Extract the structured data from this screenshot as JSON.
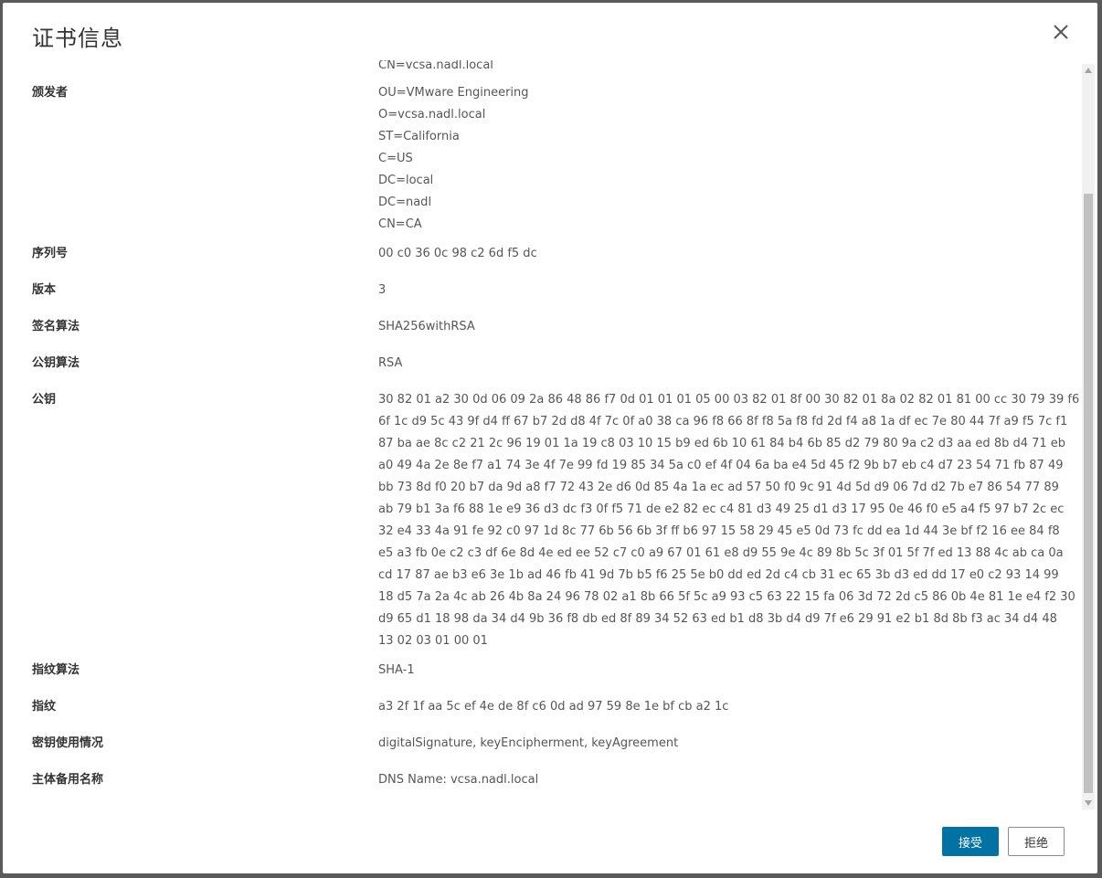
{
  "dialog": {
    "title": "证书信息",
    "close_icon": "close-icon"
  },
  "fields": {
    "subject_cn_partial": "CN=vcsa.nadl.local",
    "issuer": {
      "label": "颁发者",
      "lines": [
        "OU=VMware Engineering",
        "O=vcsa.nadl.local",
        "ST=California",
        "C=US",
        "DC=local",
        "DC=nadl",
        "CN=CA"
      ]
    },
    "serial": {
      "label": "序列号",
      "value": "00 c0 36 0c 98 c2 6d f5 dc"
    },
    "version": {
      "label": "版本",
      "value": "3"
    },
    "signature_algorithm": {
      "label": "签名算法",
      "value": "SHA256withRSA"
    },
    "public_key_algorithm": {
      "label": "公钥算法",
      "value": "RSA"
    },
    "public_key": {
      "label": "公钥",
      "lines": [
        "30 82 01 a2 30 0d 06 09 2a 86 48 86 f7 0d 01 01 01 05 00 03 82 01 8f 00 30 82 01 8a 02 82 01 81 00 cc 30 79 39 f6",
        "6f 1c d9 5c 43 9f d4 ff 67 b7 2d d8 4f 7c 0f a0 38 ca 96 f8 66 8f f8 5a f8 fd 2d f4 a8 1a df ec 7e 80 44 7f a9 f5 7c f1",
        "87 ba ae 8c c2 21 2c 96 19 01 1a 19 c8 03 10 15 b9 ed 6b 10 61 84 b4 6b 85 d2 79 80 9a c2 d3 aa ed 8b d4 71 eb",
        "a0 49 4a 2e 8e f7 a1 74 3e 4f 7e 99 fd 19 85 34 5a c0 ef 4f 04 6a ba e4 5d 45 f2 9b b7 eb c4 d7 23 54 71 fb 87 49",
        "bb 73 8d f0 20 b7 da 9d a8 f7 72 43 2e d6 0d 85 4a 1a ec ad 57 50 f0 9c 91 4d 5d d9 06 7d d2 7b e7 86 54 77 89",
        "ab 79 b1 3a f6 88 1e e9 36 d3 dc f3 0f f5 71 de e2 82 ec c4 81 d3 49 25 d1 d3 17 95 0e 46 f0 e5 a4 f5 97 b7 2c ec",
        "32 e4 33 4a 91 fe 92 c0 97 1d 8c 77 6b 56 6b 3f ff b6 97 15 58 29 45 e5 0d 73 fc dd ea 1d 44 3e bf f2 16 ee 84 f8",
        "e5 a3 fb 0e c2 c3 df 6e 8d 4e ed ee 52 c7 c0 a9 67 01 61 e8 d9 55 9e 4c 89 8b 5c 3f 01 5f 7f ed 13 88 4c ab ca 0a",
        "cd 17 87 ae b3 e6 3e 1b ad 46 fb 41 9d 7b b5 f6 25 5e b0 dd ed 2d c4 cb 31 ec 65 3b d3 ed dd 17 e0 c2 93 14 99",
        "18 d5 7a 2a 4c ab 26 4b 8a 24 96 78 02 a1 8b 66 5f 5c a9 93 c5 63 22 15 fa 06 3d 72 2d c5 86 0b 4e 81 1e e4 f2 30",
        "d9 65 d1 18 98 da 34 d4 9b 36 f8 db ed 8f 89 34 52 63 ed b1 d8 3b d4 d9 7f e6 29 91 e2 b1 8d 8b f3 ac 34 d4 48",
        "13 02 03 01 00 01"
      ]
    },
    "thumbprint_algorithm": {
      "label": "指纹算法",
      "value": "SHA-1"
    },
    "thumbprint": {
      "label": "指纹",
      "value": "a3 2f 1f aa 5c ef 4e de 8f c6 0d ad 97 59 8e 1e bf cb a2 1c"
    },
    "key_usage": {
      "label": "密钥使用情况",
      "value": "digitalSignature, keyEncipherment, keyAgreement"
    },
    "subject_alt_name": {
      "label": "主体备用名称",
      "value": "DNS Name: vcsa.nadl.local"
    }
  },
  "buttons": {
    "accept": "接受",
    "reject": "拒绝"
  },
  "colors": {
    "accent": "#0072a3",
    "overlay": "#5a5a5a"
  }
}
